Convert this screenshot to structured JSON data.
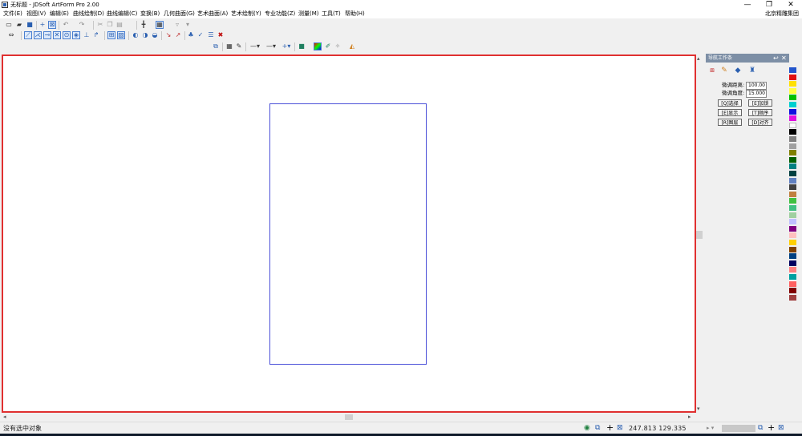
{
  "window": {
    "title": "无标题 - JDSoft ArtForm Pro 2.00",
    "minimize": "—",
    "restore": "❐",
    "close": "✕"
  },
  "menu": {
    "items": [
      "文件(E)",
      "视图(V)",
      "编辑(E)",
      "曲线绘制(D)",
      "曲线编辑(C)",
      "变换(B)",
      "几何曲面(G)",
      "艺术曲面(A)",
      "艺术绘制(Y)",
      "专业功能(Z)",
      "测量(M)",
      "工具(T)",
      "帮助(H)"
    ],
    "org": "北京精雕集团"
  },
  "panel": {
    "title": "导航工作条",
    "fine_distance_label": "微调距离:",
    "fine_distance_value": "100.00",
    "fine_angle_label": "微调角度:",
    "fine_angle_value": "15.000",
    "buttons": [
      [
        "[Q]选择",
        "[E]加锁"
      ],
      [
        "[E]显示",
        "[T]顺序"
      ],
      [
        "[R]图层",
        "[D]对齐"
      ]
    ]
  },
  "status": {
    "message": "没有选中对象",
    "coords": "247.813  129.335"
  },
  "palette": [
    "#2255cc",
    "#e01010",
    "#ffe000",
    "#ffff40",
    "#00c000",
    "#00d0d0",
    "#1010e0",
    "#e010e0",
    "#ffffff",
    "#000000",
    "#808080",
    "#a0a0a0",
    "#808000",
    "#006000",
    "#008080",
    "#004040",
    "#6080c0",
    "#404040",
    "#c08040",
    "#40c040",
    "#40c080",
    "#a0d0a0",
    "#c0c0ff",
    "#800080",
    "#ffc0c0",
    "#ffd000",
    "#804000",
    "#004080",
    "#000060",
    "#ff8080",
    "#00a0a0",
    "#ff6060",
    "#800000",
    "#a04040"
  ],
  "colors": {
    "canvas_border": "#e03030",
    "artboard_border": "#4a50d8",
    "panel_header": "#7d8fa6"
  },
  "icons": {
    "toolbar1": [
      "new-file-icon",
      "open-file-icon",
      "save-icon",
      "cross-cursor-icon",
      "box-select-icon",
      "undo-icon",
      "redo-icon",
      "cut-icon",
      "copy-icon",
      "paste-icon",
      "crosshair-icon",
      "view-icon",
      "layer-icon",
      "trash-icon"
    ],
    "toolbar2": [
      "move-arrows-icon",
      "snap-line-icon",
      "snap-tangent-icon",
      "snap-mid-icon",
      "snap-cross-icon",
      "snap-center-icon",
      "snap-quadrant-icon",
      "snap-perp-icon",
      "snap-end-icon",
      "grid-snap-icon",
      "grid-icon",
      "surface1-icon",
      "surface2-icon",
      "surface3-icon",
      "tool-a-icon",
      "tool-b-icon",
      "tool-c-icon",
      "tool-d-icon",
      "delete-icon"
    ],
    "toolbar3": [
      "node-icon",
      "grid-dots-icon",
      "pen-icon",
      "line-style-icon",
      "line-width-icon",
      "plus-icon",
      "fill-color-icon",
      "gradient-icon",
      "brush-icon",
      "spray-icon",
      "bucket-icon"
    ]
  }
}
